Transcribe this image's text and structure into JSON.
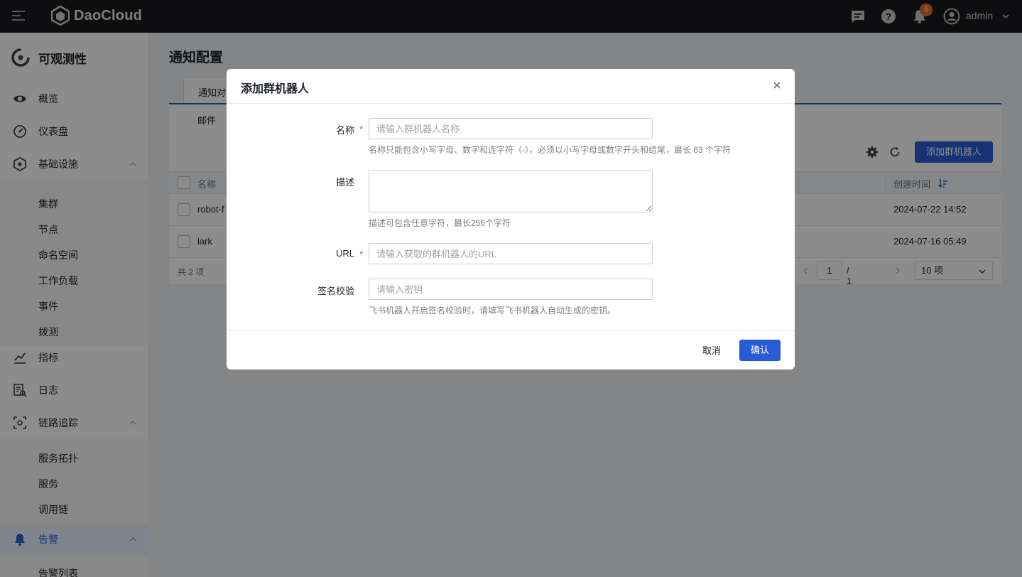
{
  "topbar": {
    "brand": "DaoCloud",
    "notification_count": "5",
    "user": "admin"
  },
  "sidebar": {
    "title": "可观测性",
    "items": [
      {
        "label": "概览",
        "icon": "eye-icon"
      },
      {
        "label": "仪表盘",
        "icon": "dashboard-icon"
      },
      {
        "label": "基础设施",
        "icon": "hexagon-icon",
        "expanded": true
      },
      {
        "label": "集群"
      },
      {
        "label": "节点"
      },
      {
        "label": "命名空间"
      },
      {
        "label": "工作负载"
      },
      {
        "label": "事件"
      },
      {
        "label": "拨测"
      },
      {
        "label": "指标",
        "icon": "chart-icon"
      },
      {
        "label": "日志",
        "icon": "log-icon"
      },
      {
        "label": "链路追踪",
        "icon": "trace-icon",
        "expanded": true
      },
      {
        "label": "服务拓扑"
      },
      {
        "label": "服务"
      },
      {
        "label": "调用链"
      },
      {
        "label": "告警",
        "icon": "bell-icon",
        "expanded": true,
        "active": true
      },
      {
        "label": "告警列表"
      }
    ]
  },
  "main": {
    "page_title": "通知配置",
    "active_tab": "通知对",
    "subtab": "邮件",
    "add_button": "添加群机器人",
    "table": {
      "col_name": "名称",
      "col_time": "创建时间",
      "rows": [
        {
          "name": "robot-f",
          "time": "2024-07-22 14:52"
        },
        {
          "name": "lark",
          "time": "2024-07-16 05:49"
        }
      ]
    },
    "total": "共 2 项",
    "page_current": "1",
    "page_total": "/ 1",
    "page_size": "10 项"
  },
  "modal": {
    "title": "添加群机器人",
    "fields": {
      "name": {
        "label": "名称",
        "required": "*",
        "placeholder": "请输入群机器人名称",
        "help": "名称只能包含小写字母、数字和连字符（-），必须以小写字母或数字开头和结尾，最长 63 个字符"
      },
      "desc": {
        "label": "描述",
        "help": "描述可包含任意字符，最长256个字符"
      },
      "url": {
        "label": "URL",
        "required": "*",
        "placeholder": "请输入获取的群机器人的URL"
      },
      "sign": {
        "label": "签名校验",
        "placeholder": "请输入密钥",
        "help": "飞书机器人开启签名校验时，请填写飞书机器人自动生成的密钥。"
      }
    },
    "cancel": "取消",
    "confirm": "确认"
  },
  "colors": {
    "primary": "#2a5bd7",
    "topbar": "#1a1b1e",
    "required": "#e6302e",
    "badge": "#e6702e"
  }
}
